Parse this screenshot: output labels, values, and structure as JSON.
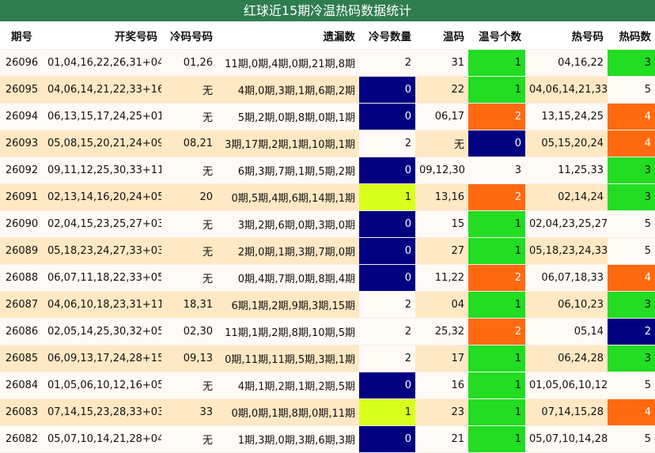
{
  "title": "红球近15期冷温热码数据统计",
  "colors": {
    "title_bg": "#2e7d4f",
    "row_light": "#fffaf5",
    "row_dark": "#ffe8c4",
    "navy": "#000080",
    "lime": "#d9ff1c",
    "green": "#22dd22",
    "orange": "#ff6a10"
  },
  "headers": [
    "期号",
    "开奖号码",
    "冷码号码",
    "遗漏数",
    "冷号数量",
    "温码",
    "温号个数",
    "热号码",
    "热码数"
  ],
  "rows": [
    {
      "issue": "26096",
      "draw": "01,04,16,22,26,31+04",
      "cold": "01,26",
      "miss": "11期,0期,4期,0期,21期,8期",
      "cold_count": "2",
      "warm": "31",
      "warm_count": "1",
      "hot": "04,16,22",
      "hot_count": "3"
    },
    {
      "issue": "26095",
      "draw": "04,06,14,21,22,33+16",
      "cold": "无",
      "miss": "4期,0期,3期,1期,6期,2期",
      "cold_count": "0",
      "warm": "22",
      "warm_count": "1",
      "hot": "04,06,14,21,33",
      "hot_count": "5"
    },
    {
      "issue": "26094",
      "draw": "06,13,15,17,24,25+01",
      "cold": "无",
      "miss": "5期,2期,0期,8期,0期,1期",
      "cold_count": "0",
      "warm": "06,17",
      "warm_count": "2",
      "hot": "13,15,24,25",
      "hot_count": "4"
    },
    {
      "issue": "26093",
      "draw": "05,08,15,20,21,24+09",
      "cold": "08,21",
      "miss": "3期,17期,2期,1期,10期,1期",
      "cold_count": "2",
      "warm": "无",
      "warm_count": "0",
      "hot": "05,15,20,24",
      "hot_count": "4"
    },
    {
      "issue": "26092",
      "draw": "09,11,12,25,30,33+11",
      "cold": "无",
      "miss": "6期,3期,7期,1期,5期,2期",
      "cold_count": "0",
      "warm": "09,12,30",
      "warm_count": "3",
      "hot": "11,25,33",
      "hot_count": "3"
    },
    {
      "issue": "26091",
      "draw": "02,13,14,16,20,24+05",
      "cold": "20",
      "miss": "0期,5期,4期,6期,14期,1期",
      "cold_count": "1",
      "warm": "13,16",
      "warm_count": "2",
      "hot": "02,14,24",
      "hot_count": "3"
    },
    {
      "issue": "26090",
      "draw": "02,04,15,23,25,27+03",
      "cold": "无",
      "miss": "3期,2期,6期,0期,3期,0期",
      "cold_count": "0",
      "warm": "15",
      "warm_count": "1",
      "hot": "02,04,23,25,27",
      "hot_count": "5"
    },
    {
      "issue": "26089",
      "draw": "05,18,23,24,27,33+03",
      "cold": "无",
      "miss": "2期,0期,1期,3期,7期,0期",
      "cold_count": "0",
      "warm": "27",
      "warm_count": "1",
      "hot": "05,18,23,24,33",
      "hot_count": "5"
    },
    {
      "issue": "26088",
      "draw": "06,07,11,18,22,33+05",
      "cold": "无",
      "miss": "0期,4期,7期,0期,8期,4期",
      "cold_count": "0",
      "warm": "11,22",
      "warm_count": "2",
      "hot": "06,07,18,33",
      "hot_count": "4"
    },
    {
      "issue": "26087",
      "draw": "04,06,10,18,23,31+11",
      "cold": "18,31",
      "miss": "6期,1期,2期,9期,3期,15期",
      "cold_count": "2",
      "warm": "04",
      "warm_count": "1",
      "hot": "06,10,23",
      "hot_count": "3"
    },
    {
      "issue": "26086",
      "draw": "02,05,14,25,30,32+05",
      "cold": "02,30",
      "miss": "11期,1期,2期,8期,10期,5期",
      "cold_count": "2",
      "warm": "25,32",
      "warm_count": "2",
      "hot": "05,14",
      "hot_count": "2"
    },
    {
      "issue": "26085",
      "draw": "06,09,13,17,24,28+15",
      "cold": "09,13",
      "miss": "0期,11期,11期,5期,3期,1期",
      "cold_count": "2",
      "warm": "17",
      "warm_count": "1",
      "hot": "06,24,28",
      "hot_count": "3"
    },
    {
      "issue": "26084",
      "draw": "01,05,06,10,12,16+05",
      "cold": "无",
      "miss": "4期,1期,2期,1期,2期,5期",
      "cold_count": "0",
      "warm": "16",
      "warm_count": "1",
      "hot": "01,05,06,10,12",
      "hot_count": "5"
    },
    {
      "issue": "26083",
      "draw": "07,14,15,23,28,33+03",
      "cold": "33",
      "miss": "0期,0期,1期,8期,0期,11期",
      "cold_count": "1",
      "warm": "23",
      "warm_count": "1",
      "hot": "07,14,15,28",
      "hot_count": "4"
    },
    {
      "issue": "26082",
      "draw": "05,07,10,14,21,28+04",
      "cold": "无",
      "miss": "1期,3期,0期,3期,6期,3期",
      "cold_count": "0",
      "warm": "21",
      "warm_count": "1",
      "hot": "05,07,10,14,28",
      "hot_count": "5"
    }
  ]
}
